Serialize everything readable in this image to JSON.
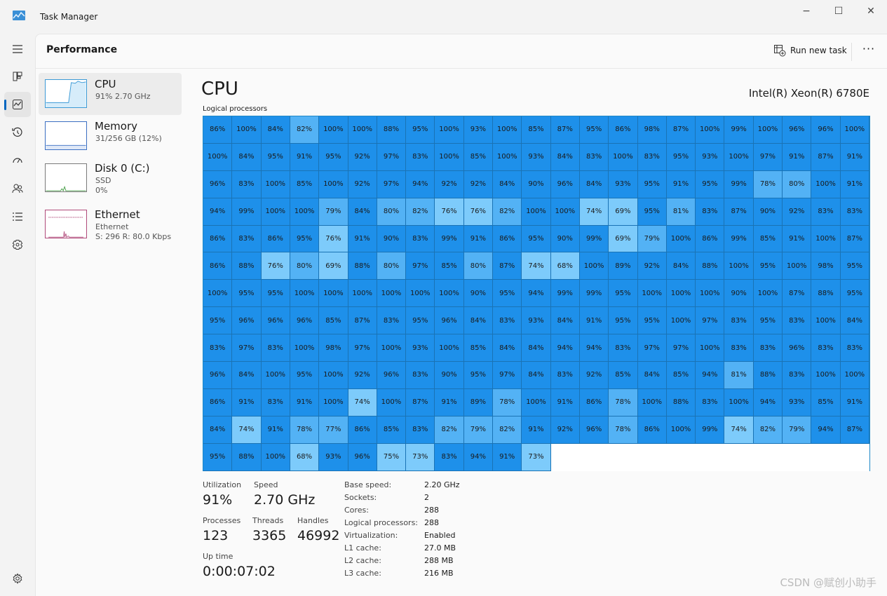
{
  "window": {
    "title": "Task Manager",
    "controls": [
      "−",
      "☐",
      "✕"
    ]
  },
  "header": {
    "title": "Performance",
    "run_new_task": "Run new task",
    "more": "···"
  },
  "nav": [
    "hamburger-icon",
    "processes-icon",
    "performance-icon",
    "app-history-icon",
    "startup-apps-icon",
    "users-icon",
    "details-icon",
    "services-icon",
    "settings-icon"
  ],
  "devices": [
    {
      "name": "CPU",
      "lines": [
        "91% 2.70 GHz"
      ],
      "color": "#3c9ad6"
    },
    {
      "name": "Memory",
      "lines": [
        "31/256 GB (12%)"
      ],
      "color": "#3b6fc2"
    },
    {
      "name": "Disk 0 (C:)",
      "lines": [
        "SSD",
        "0%"
      ],
      "color": "#4aa04a"
    },
    {
      "name": "Ethernet",
      "lines": [
        "Ethernet",
        "S: 296 R: 80.0 Kbps"
      ],
      "color": "#b04a7a"
    }
  ],
  "cpu": {
    "title": "CPU",
    "model": "Intel(R) Xeon(R) 6780E",
    "logical_label": "Logical processors",
    "colors": {
      "high": "#1e90ea",
      "mid": "#53b2f5",
      "low": "#7dcbfb"
    },
    "cells": [
      86,
      100,
      84,
      82,
      100,
      100,
      88,
      95,
      100,
      93,
      100,
      85,
      87,
      95,
      86,
      98,
      87,
      100,
      99,
      100,
      96,
      96,
      100,
      100,
      84,
      95,
      91,
      95,
      92,
      97,
      83,
      100,
      85,
      100,
      93,
      84,
      83,
      100,
      83,
      95,
      93,
      100,
      97,
      91,
      87,
      91,
      96,
      83,
      100,
      85,
      100,
      92,
      97,
      94,
      92,
      92,
      84,
      90,
      96,
      84,
      93,
      95,
      91,
      95,
      99,
      78,
      80,
      100,
      91,
      94,
      99,
      100,
      100,
      79,
      84,
      80,
      82,
      76,
      76,
      82,
      100,
      100,
      74,
      69,
      95,
      81,
      83,
      87,
      90,
      92,
      83,
      83,
      86,
      83,
      86,
      95,
      76,
      91,
      90,
      83,
      99,
      91,
      86,
      95,
      90,
      99,
      69,
      79,
      100,
      86,
      99,
      85,
      91,
      100,
      87,
      86,
      88,
      76,
      80,
      69,
      88,
      80,
      97,
      85,
      80,
      87,
      74,
      68,
      100,
      89,
      92,
      84,
      88,
      100,
      95,
      100,
      98,
      95,
      100,
      95,
      95,
      100,
      100,
      100,
      100,
      100,
      100,
      90,
      95,
      94,
      99,
      99,
      95,
      100,
      100,
      100,
      90,
      100,
      87,
      88,
      95,
      95,
      96,
      96,
      96,
      85,
      87,
      83,
      95,
      96,
      84,
      83,
      93,
      84,
      91,
      95,
      95,
      100,
      97,
      83,
      95,
      83,
      100,
      84,
      83,
      97,
      83,
      100,
      98,
      97,
      100,
      93,
      100,
      85,
      84,
      84,
      94,
      94,
      83,
      97,
      97,
      100,
      83,
      83,
      96,
      83,
      83,
      96,
      84,
      100,
      95,
      100,
      92,
      96,
      83,
      90,
      95,
      97,
      84,
      83,
      92,
      85,
      84,
      85,
      94,
      81,
      88,
      83,
      100,
      100,
      86,
      91,
      83,
      91,
      100,
      74,
      100,
      87,
      91,
      89,
      78,
      100,
      91,
      86,
      78,
      100,
      88,
      83,
      100,
      94,
      93,
      85,
      91,
      84,
      74,
      91,
      78,
      77,
      86,
      85,
      83,
      82,
      79,
      82,
      91,
      92,
      96,
      78,
      86,
      100,
      99,
      74,
      82,
      79,
      94,
      87,
      95,
      88,
      100,
      68,
      93,
      96,
      75,
      73,
      83,
      94,
      91,
      73
    ]
  },
  "stats": {
    "utilization": {
      "label": "Utilization",
      "value": "91%"
    },
    "speed": {
      "label": "Speed",
      "value": "2.70 GHz"
    },
    "processes": {
      "label": "Processes",
      "value": "123"
    },
    "threads": {
      "label": "Threads",
      "value": "3365"
    },
    "handles": {
      "label": "Handles",
      "value": "46992"
    },
    "uptime": {
      "label": "Up time",
      "value": "0:00:07:02"
    }
  },
  "specs": [
    {
      "k": "Base speed:",
      "v": "2.20 GHz"
    },
    {
      "k": "Sockets:",
      "v": "2"
    },
    {
      "k": "Cores:",
      "v": "288"
    },
    {
      "k": "Logical processors:",
      "v": "288"
    },
    {
      "k": "Virtualization:",
      "v": "Enabled"
    },
    {
      "k": "L1 cache:",
      "v": "27.0 MB"
    },
    {
      "k": "L2 cache:",
      "v": "288 MB"
    },
    {
      "k": "L3 cache:",
      "v": "216 MB"
    }
  ],
  "watermark": "CSDN @赋创小助手"
}
